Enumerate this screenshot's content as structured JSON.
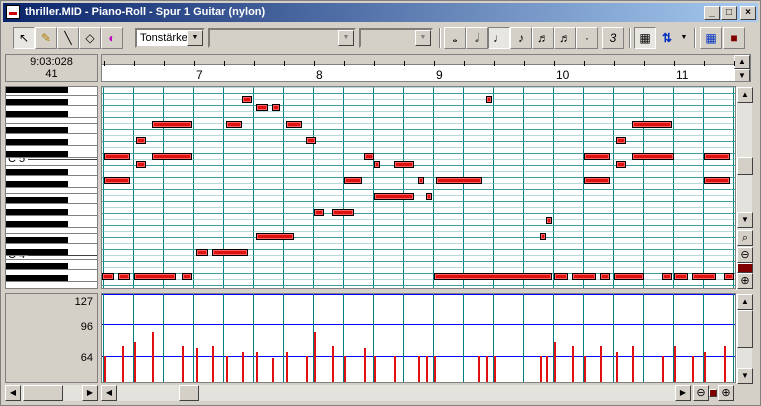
{
  "window": {
    "title": "thriller.MID - Piano-Roll - Spur 1 Guitar (nylon)",
    "controls": {
      "minimize": "_",
      "maximize": "□",
      "close": "×"
    }
  },
  "toolbar": {
    "tools": [
      {
        "name": "select-tool-button",
        "icon": "arrow-pointer",
        "glyph": "↖",
        "pressed": true
      },
      {
        "name": "pencil-tool-button",
        "icon": "pencil",
        "glyph": "✎",
        "pressed": false
      },
      {
        "name": "line-tool-button",
        "icon": "line",
        "glyph": "╲",
        "pressed": false
      },
      {
        "name": "eraser-tool-button",
        "icon": "eraser",
        "glyph": "◇",
        "pressed": false
      },
      {
        "name": "speaker-tool-button",
        "icon": "speaker",
        "glyph": "◐",
        "pressed": false
      }
    ],
    "controller_select": "Tonstärke",
    "combo2": "",
    "combo3": "",
    "note_lengths": [
      {
        "name": "whole-note-button",
        "glyph": "𝅝",
        "pressed": false
      },
      {
        "name": "half-note-button",
        "glyph": "𝅗𝅥",
        "pressed": false
      },
      {
        "name": "quarter-note-button",
        "glyph": "♩",
        "pressed": true
      },
      {
        "name": "eighth-note-button",
        "glyph": "♪",
        "pressed": false
      },
      {
        "name": "sixteenth-note-button",
        "glyph": "♬",
        "pressed": false
      },
      {
        "name": "thirtysecond-note-button",
        "glyph": "♬",
        "pressed": false
      },
      {
        "name": "dotted-button",
        "glyph": "·",
        "pressed": false
      },
      {
        "name": "triplet-button",
        "glyph": "3",
        "pressed": false
      }
    ],
    "right_tools": [
      {
        "name": "grid-button",
        "icon": "grid",
        "glyph": "▦",
        "pressed": true
      },
      {
        "name": "snap-button",
        "icon": "up-down-arrows",
        "glyph": "⇅",
        "pressed": false
      },
      {
        "name": "view-grid-button",
        "icon": "table",
        "glyph": "▦",
        "pressed": false
      },
      {
        "name": "record-button",
        "icon": "stop-square",
        "glyph": "■",
        "pressed": false
      }
    ]
  },
  "position": {
    "time": "9:03:028",
    "measure": "41"
  },
  "ruler": {
    "measures": [
      "7",
      "8",
      "9",
      "10",
      "11"
    ]
  },
  "keyboard": {
    "labels": [
      "C 5",
      "C 4"
    ]
  },
  "velocity": {
    "labels": [
      "127",
      "96",
      "64"
    ]
  },
  "colors": {
    "note": "#e01010",
    "grid": "#008080",
    "bar": "#0000ff",
    "title_start": "#0a246a",
    "title_end": "#a6caf0"
  }
}
